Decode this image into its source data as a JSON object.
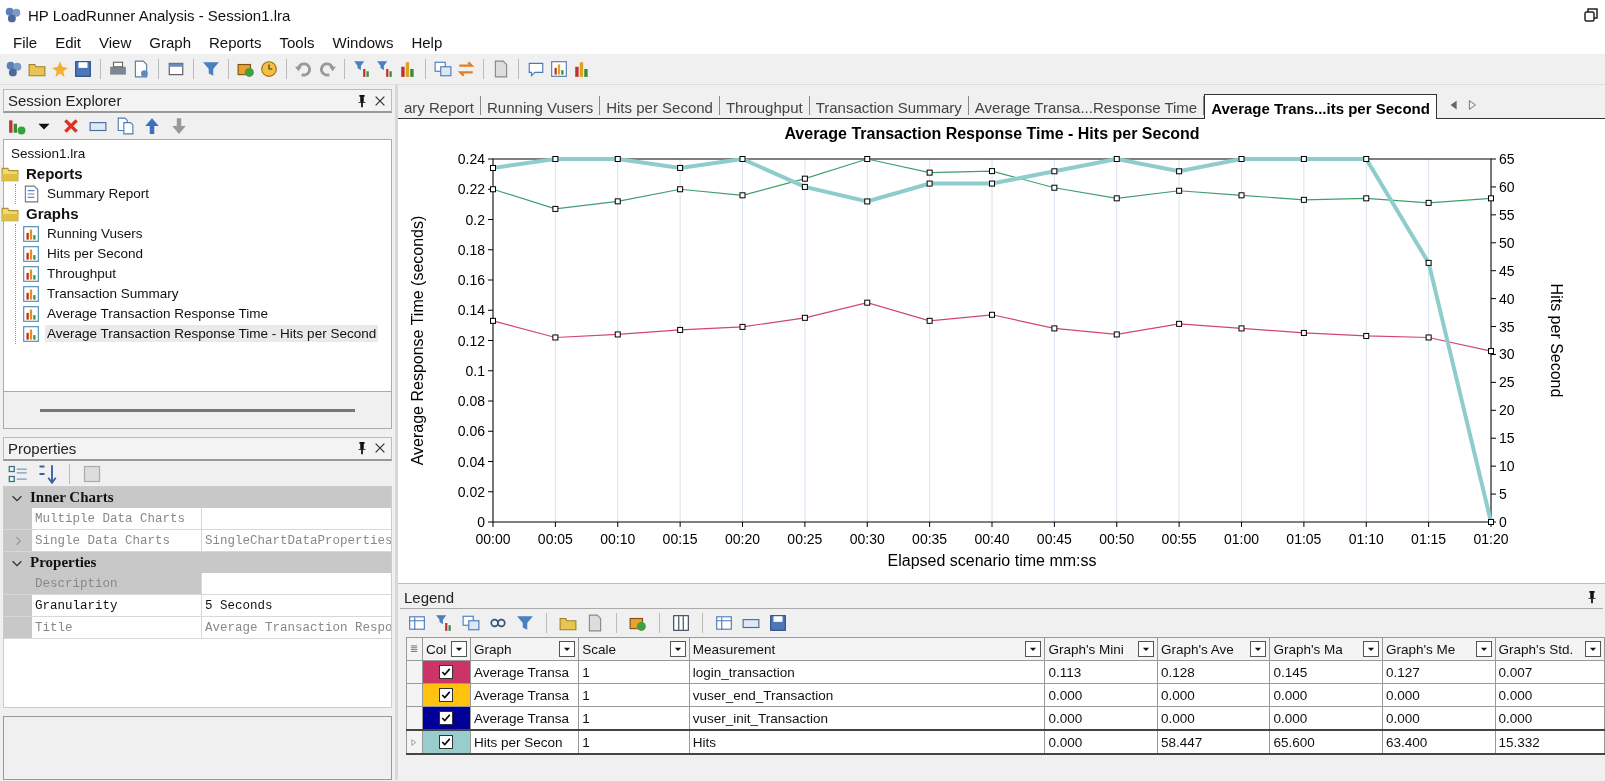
{
  "window": {
    "title": "HP LoadRunner Analysis - Session1.lra"
  },
  "menu": [
    "File",
    "Edit",
    "View",
    "Graph",
    "Reports",
    "Tools",
    "Windows",
    "Help"
  ],
  "session_explorer": {
    "title": "Session Explorer",
    "tree": {
      "label": "Session1.lra",
      "children": [
        {
          "label": "Reports",
          "kind": "folder",
          "selected": false,
          "children": [
            {
              "label": "Summary Report",
              "kind": "report",
              "selected": false
            }
          ]
        },
        {
          "label": "Graphs",
          "kind": "folder",
          "selected": false,
          "children": [
            {
              "label": "Running Vusers",
              "kind": "graph",
              "selected": false
            },
            {
              "label": "Hits per Second",
              "kind": "graph",
              "selected": false
            },
            {
              "label": "Throughput",
              "kind": "graph",
              "selected": false
            },
            {
              "label": "Transaction Summary",
              "kind": "graph",
              "selected": false
            },
            {
              "label": "Average Transaction Response Time",
              "kind": "graph",
              "selected": false
            },
            {
              "label": "Average Transaction Response Time - Hits per Second",
              "kind": "graph",
              "selected": true
            }
          ]
        }
      ]
    }
  },
  "properties": {
    "title": "Properties",
    "categories": [
      {
        "label": "Inner Charts",
        "expanded": true,
        "rows": [
          {
            "name": "Multiple Data Charts",
            "disabled": true,
            "selected": false,
            "has_children": false
          },
          {
            "name": "Single Data Charts",
            "value": "SingleChartDataProperties",
            "disabled": true,
            "selected": false,
            "has_children": true
          }
        ]
      },
      {
        "label": "Properties",
        "expanded": true,
        "rows": [
          {
            "name": "Description",
            "disabled": true,
            "selected": true,
            "has_children": false
          },
          {
            "name": "Granularity",
            "value": "5 Seconds",
            "disabled": false,
            "selected": false,
            "has_children": false
          },
          {
            "name": "Title",
            "value": "Average Transaction Respo",
            "disabled": true,
            "selected": false,
            "has_children": false
          }
        ]
      }
    ]
  },
  "tabs": [
    {
      "label": "ary Report",
      "selected": false
    },
    {
      "label": "Running Vusers",
      "selected": false
    },
    {
      "label": "Hits per Second",
      "selected": false
    },
    {
      "label": "Throughput",
      "selected": false
    },
    {
      "label": "Transaction Summary",
      "selected": false
    },
    {
      "label": "Average Transa...Response Time",
      "selected": false
    },
    {
      "label": "Average Trans...its per Second",
      "selected": true
    }
  ],
  "chart": {
    "chart_data": {
      "type": "line",
      "title": "Average Transaction Response Time - Hits per Second",
      "xlabel": "Elapsed scenario time mm:ss",
      "ylabel": "Average Response Time (seconds)",
      "y2label": "Hits per Second",
      "categories": [
        "00:00",
        "00:05",
        "00:10",
        "00:15",
        "00:20",
        "00:25",
        "00:30",
        "00:35",
        "00:40",
        "00:45",
        "00:50",
        "00:55",
        "01:00",
        "01:05",
        "01:10",
        "01:15",
        "01:20"
      ],
      "grid": "x",
      "ylim": [
        0,
        0.24
      ],
      "yticks": [
        0,
        0.02,
        0.04,
        0.06,
        0.08,
        0.1,
        0.12,
        0.14,
        0.16,
        0.18,
        0.2,
        0.22,
        0.24
      ],
      "y2lim": [
        0,
        65
      ],
      "y2ticks": [
        0,
        5,
        10,
        15,
        20,
        25,
        30,
        35,
        40,
        45,
        50,
        55,
        60,
        65
      ],
      "series": [
        {
          "color": "#d2466e",
          "marker": "square",
          "values": [
            0.133,
            0.122,
            0.124,
            0.127,
            0.129,
            0.135,
            0.145,
            0.133,
            0.137,
            0.128,
            0.124,
            0.131,
            0.128,
            0.125,
            0.123,
            0.122,
            0.113
          ]
        },
        {
          "color": "#3f9e6e",
          "marker": "square",
          "values": [
            0.22,
            0.207,
            0.212,
            0.22,
            0.216,
            0.227,
            0.24,
            0.231,
            0.232,
            0.221,
            0.214,
            0.219,
            0.216,
            0.213,
            0.214,
            0.211,
            0.214
          ]
        },
        {
          "color": "#8fcccc",
          "axis": "y2",
          "marker": "square",
          "values": [
            63.4,
            65,
            65,
            63.4,
            65,
            60,
            57.4,
            60.6,
            60.6,
            62.8,
            65,
            62.8,
            65,
            65,
            65,
            46.4,
            0
          ]
        }
      ]
    }
  },
  "legend": {
    "title": "Legend",
    "color_column": "Col",
    "columns": [
      "Graph",
      "Scale",
      "Measurement",
      "Graph's Mini",
      "Graph's Ave",
      "Graph's Ma",
      "Graph's Me",
      "Graph's Std."
    ],
    "rows": [
      {
        "color": "#cc3366",
        "checked": true,
        "selected": false,
        "cells": [
          "Average Transa",
          "1",
          "login_transaction",
          "0.113",
          "0.128",
          "0.145",
          "0.127",
          "0.007"
        ]
      },
      {
        "color": "#ffc20e",
        "checked": true,
        "selected": false,
        "cells": [
          "Average Transa",
          "1",
          "vuser_end_Transaction",
          "0.000",
          "0.000",
          "0.000",
          "0.000",
          "0.000"
        ]
      },
      {
        "color": "#000099",
        "checked": true,
        "selected": false,
        "cells": [
          "Average Transa",
          "1",
          "vuser_init_Transaction",
          "0.000",
          "0.000",
          "0.000",
          "0.000",
          "0.000"
        ]
      },
      {
        "color": "#99cccc",
        "checked": true,
        "selected": true,
        "cells": [
          "Hits per Secon",
          "1",
          "Hits",
          "0.000",
          "58.447",
          "65.600",
          "63.400",
          "15.332"
        ]
      }
    ]
  }
}
